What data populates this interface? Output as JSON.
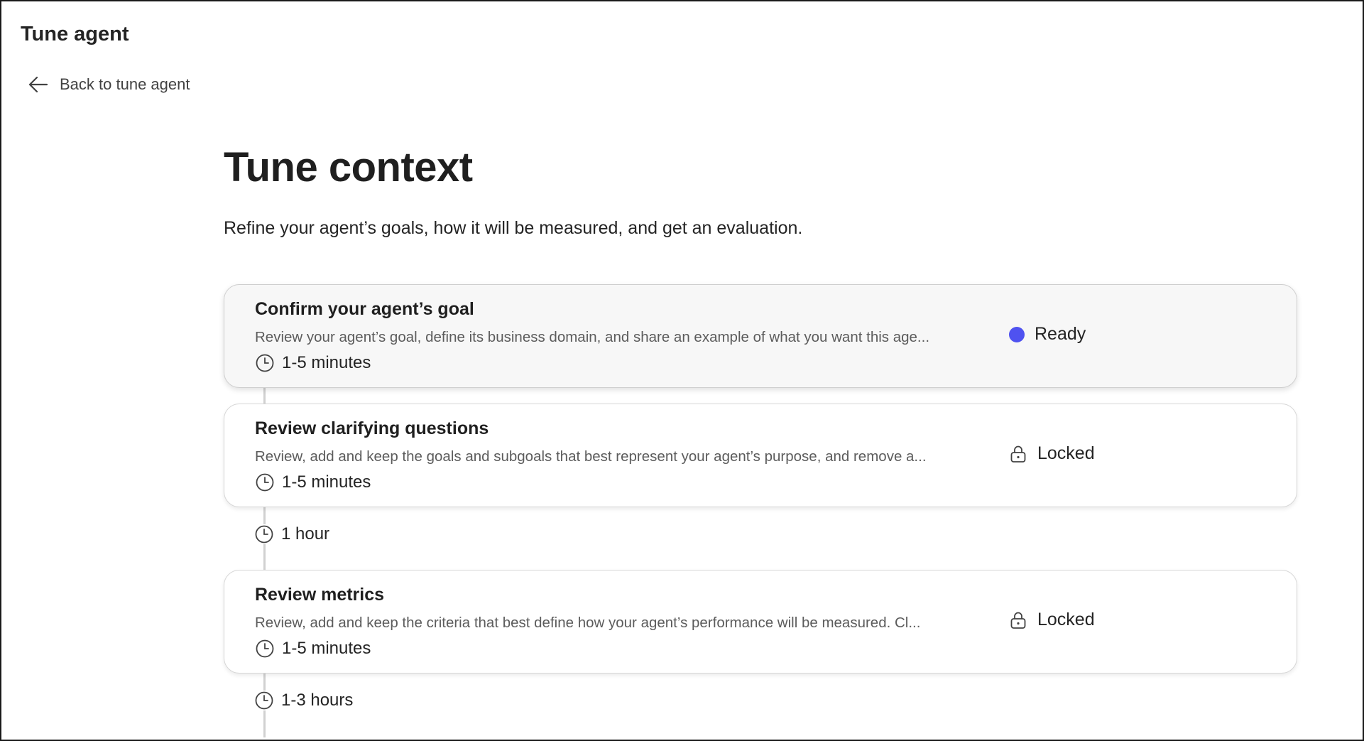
{
  "app": {
    "title": "Tune agent"
  },
  "nav": {
    "back_label": "Back to tune agent"
  },
  "page": {
    "title": "Tune context",
    "description": "Refine your agent’s goals, how it will be measured, and get an evaluation."
  },
  "steps": [
    {
      "title": "Confirm your agent’s goal",
      "description": "Review your agent’s goal, define its business domain, and share an example of what you want this age...",
      "duration": "1-5 minutes",
      "status": "Ready",
      "status_icon": "dot-icon",
      "status_color": "#4f52f0"
    },
    {
      "title": "Review clarifying questions",
      "description": "Review, add and keep the goals and subgoals that best represent your agent’s purpose, and remove a...",
      "duration": "1-5 minutes",
      "status": "Locked",
      "status_icon": "lock-icon"
    },
    {
      "title": "Review metrics",
      "description": "Review, add and keep the criteria that best define how your agent’s performance will be measured. Cl...",
      "duration": "1-5 minutes",
      "status": "Locked",
      "status_icon": "lock-icon"
    }
  ],
  "waits": [
    {
      "duration": "1 hour"
    },
    {
      "duration": "1-3 hours"
    }
  ]
}
